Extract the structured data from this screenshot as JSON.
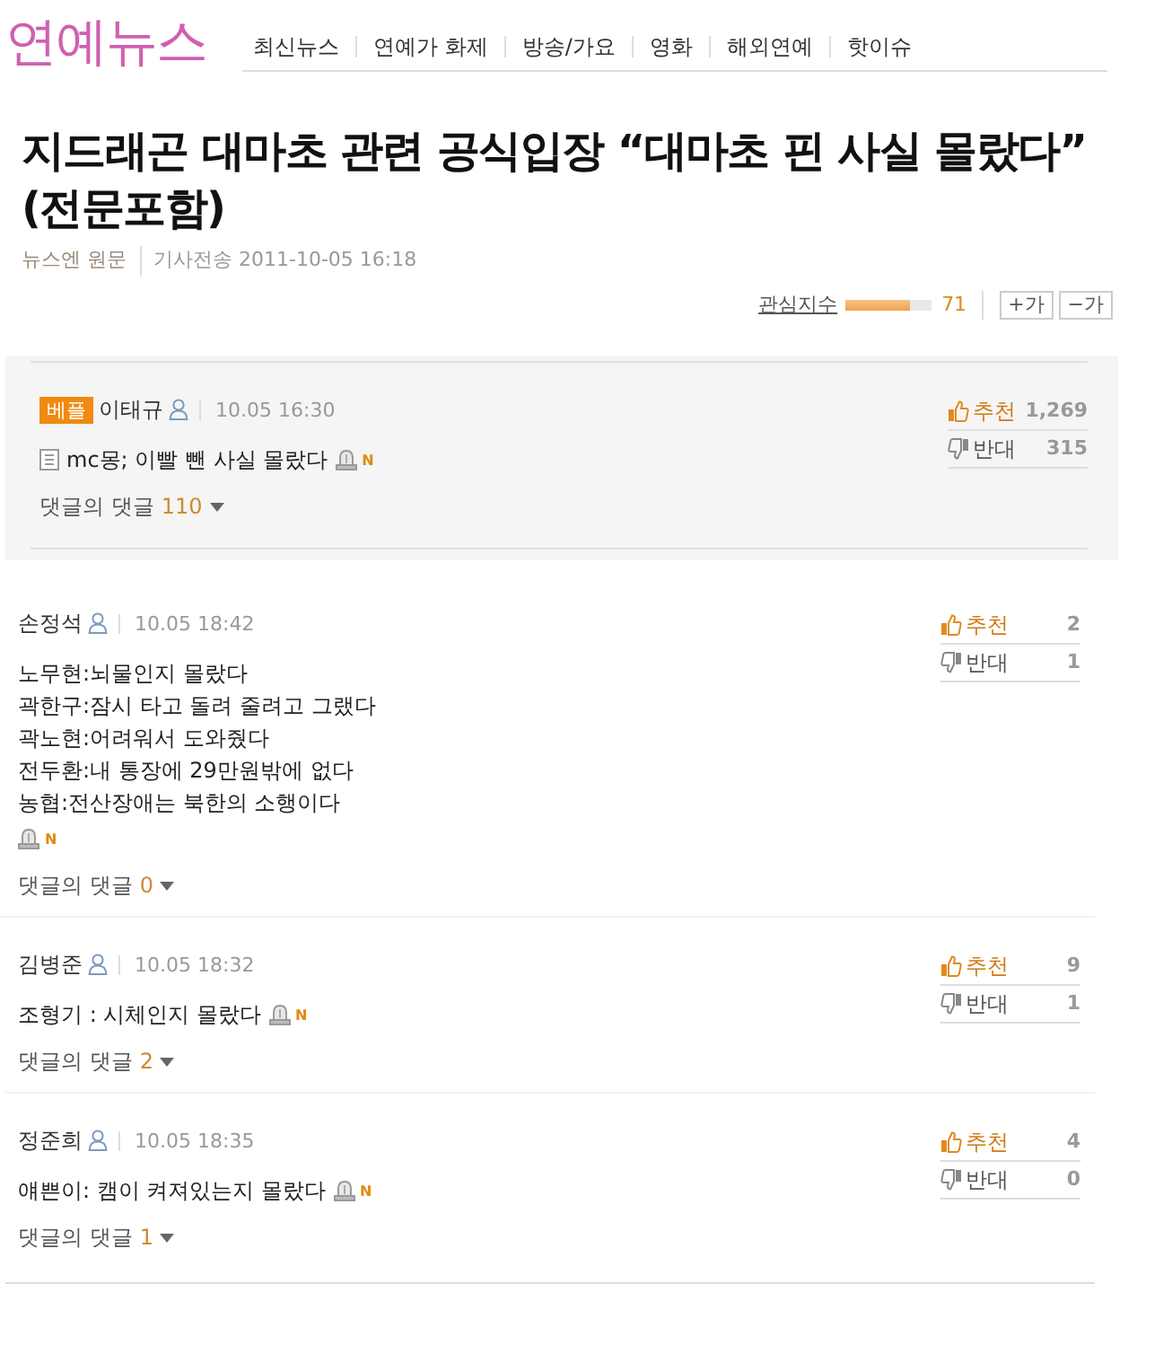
{
  "header": {
    "logo": "연예뉴스",
    "nav": [
      "최신뉴스",
      "연예가 화제",
      "방송/가요",
      "영화",
      "해외연예",
      "핫이슈"
    ]
  },
  "article": {
    "title": "지드래곤 대마초 관련 공식입장 “대마초 핀 사실 몰랐다” (전문포함)",
    "source": "뉴스엔 원문",
    "sent": "기사전송 2011-10-05 16:18"
  },
  "interest": {
    "label": "관심지수",
    "level": 0.75,
    "value": "71",
    "font_buttons": [
      "+가",
      "−가"
    ]
  },
  "comments": [
    {
      "kind": "best",
      "badge": "베플",
      "author": "이태규",
      "time": "10.05 16:30",
      "lines": [
        "mc몽; 이빨 뺀 사실 몰랐다"
      ],
      "new_mark": "N",
      "replies_label": "댓글의 댓글",
      "replies": "110",
      "up_label": "추천",
      "up": "1,269",
      "down_label": "반대",
      "down": "315"
    },
    {
      "kind": "normal",
      "author": "손정석",
      "time": "10.05 18:42",
      "lines": [
        "노무현:뇌물인지 몰랐다",
        "곽한구:잠시 타고 돌려 줄려고 그랬다",
        "곽노현:어려워서 도와줬다",
        "전두환:내 통장에 29만원밖에 없다",
        "농협:전산장애는 북한의 소행이다"
      ],
      "new_mark": "N",
      "replies_label": "댓글의 댓글",
      "replies": "0",
      "up_label": "추천",
      "up": "2",
      "down_label": "반대",
      "down": "1"
    },
    {
      "kind": "normal",
      "author": "김병준",
      "time": "10.05 18:32",
      "lines": [
        "조형기 : 시체인지 몰랐다"
      ],
      "new_mark": "N",
      "replies_label": "댓글의 댓글",
      "replies": "2",
      "up_label": "추천",
      "up": "9",
      "down_label": "반대",
      "down": "1"
    },
    {
      "kind": "normal",
      "author": "정준희",
      "time": "10.05 18:35",
      "lines": [
        "얘쁜이: 캠이 켜져있는지 몰랐다"
      ],
      "new_mark": "N",
      "replies_label": "댓글의 댓글",
      "replies": "1",
      "up_label": "추천",
      "up": "4",
      "down_label": "반대",
      "down": "0"
    }
  ]
}
